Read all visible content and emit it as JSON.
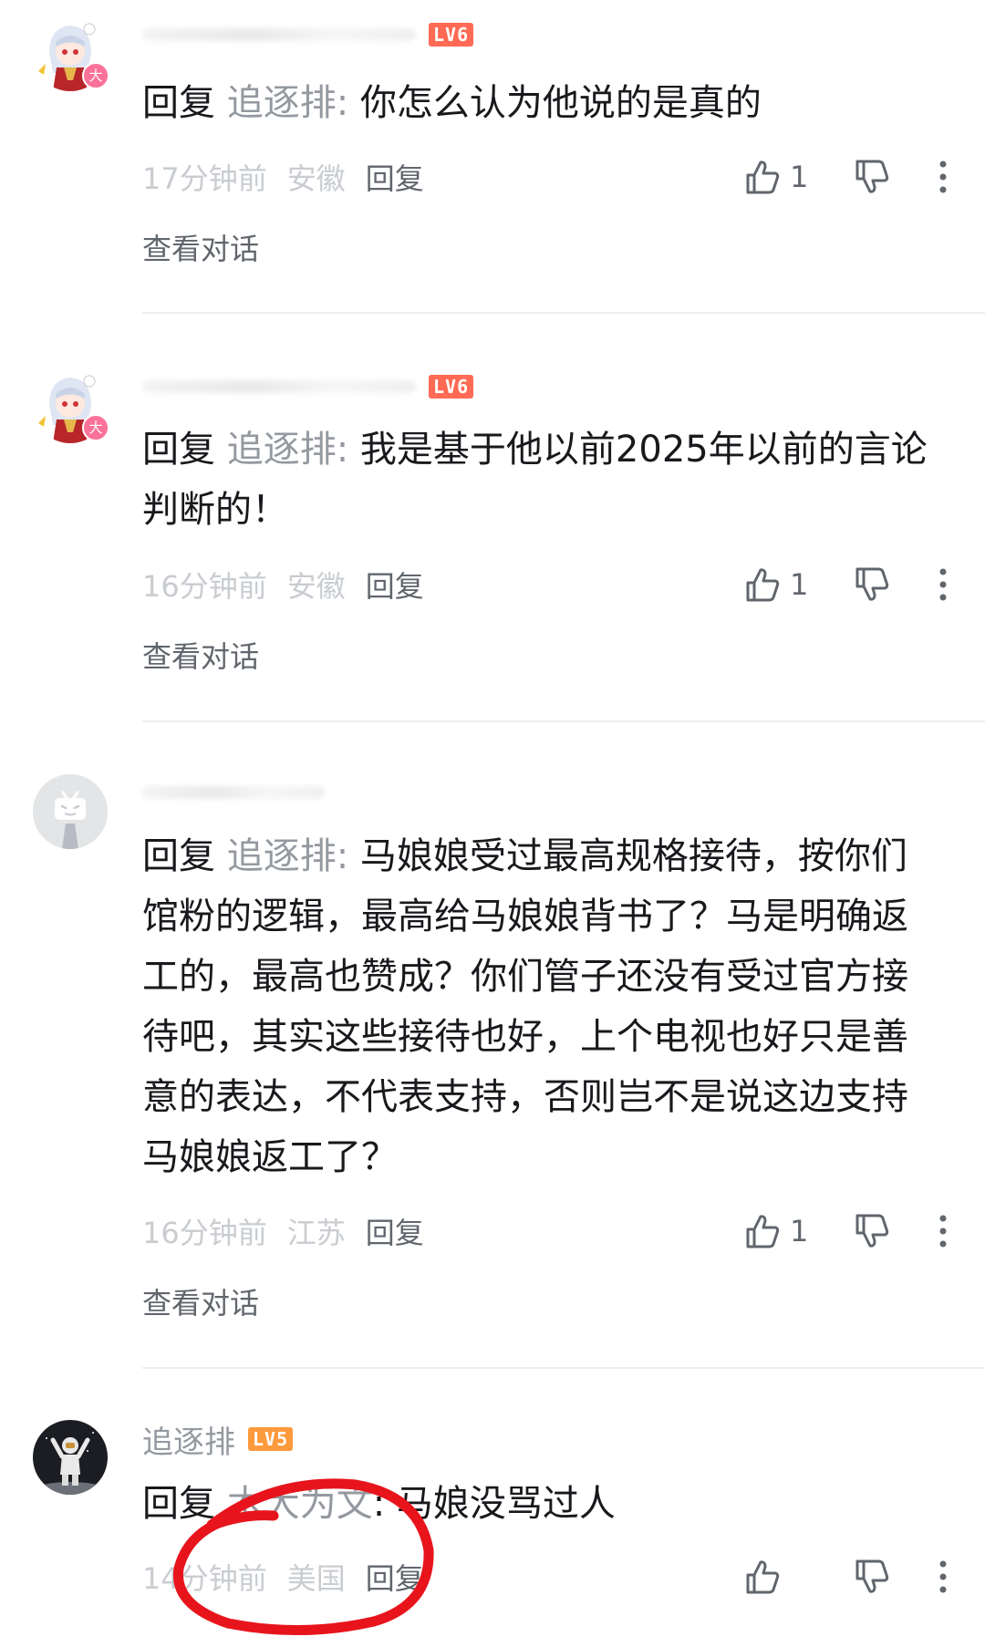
{
  "comments": [
    {
      "username": "",
      "level": "LV6",
      "level_color": "#ff6a55",
      "content": "你怎么认为他说的是真的",
      "reply_prefix": "回复 ",
      "reply_target": "追逐排",
      "reply_colon": ": ",
      "time": "17分钟前",
      "location": "安徽",
      "reply_label": "回复",
      "likes": "1",
      "view_conversation": "查看对话",
      "avatar": "anime-girl-avatar",
      "badge": "大"
    },
    {
      "username": "",
      "level": "LV6",
      "level_color": "#ff6a55",
      "content": "我是基于他以前2025年以前的言论判断的！",
      "reply_prefix": "回复 ",
      "reply_target": "追逐排",
      "reply_colon": ": ",
      "time": "16分钟前",
      "location": "安徽",
      "reply_label": "回复",
      "likes": "1",
      "view_conversation": "查看对话",
      "avatar": "anime-girl-avatar",
      "badge": "大"
    },
    {
      "username": "",
      "level": "",
      "content": "马娘娘受过最高规格接待，按你们馆粉的逻辑，最高给马娘娘背书了？马是明确返工的，最高也赞成？你们管子还没有受过官方接待吧，其实这些接待也好，上个电视也好只是善意的表达，不代表支持，否则岂不是说这边支持马娘娘返工了？",
      "reply_prefix": "回复 ",
      "reply_target": "追逐排",
      "reply_colon": ": ",
      "time": "16分钟前",
      "location": "江苏",
      "reply_label": "回复",
      "likes": "1",
      "view_conversation": "查看对话",
      "avatar": "default-tv-avatar"
    },
    {
      "username": "追逐排",
      "level": "LV5",
      "level_color": "#ff9a3c",
      "content": "马娘没骂过人",
      "reply_prefix": "回复 ",
      "reply_target": "木大为文",
      "reply_colon": ": ",
      "time": "14分钟前",
      "location": "美国",
      "reply_label": "回复",
      "likes": "",
      "avatar": "astronaut-avatar"
    }
  ],
  "annotation": {
    "color": "#e8141c"
  }
}
